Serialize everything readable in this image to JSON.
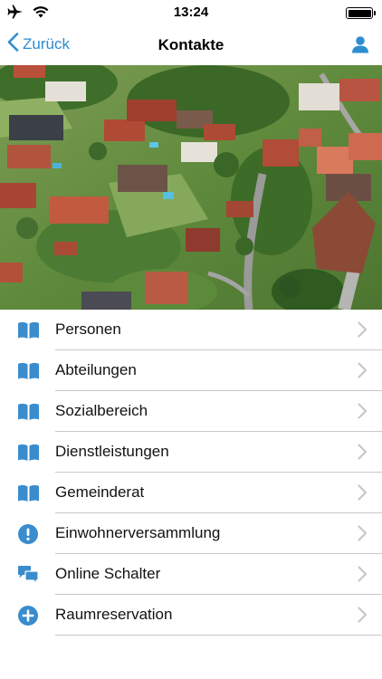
{
  "status_bar": {
    "time": "13:24",
    "icons": [
      "airplane-icon",
      "wifi-icon",
      "battery-icon"
    ]
  },
  "nav": {
    "back_label": "Zurück",
    "title": "Kontakte",
    "right_icon": "profile-icon"
  },
  "hero_image": {
    "description_icon": "village-aerial-photo"
  },
  "menu": [
    {
      "label": "Personen",
      "icon": "book-icon"
    },
    {
      "label": "Abteilungen",
      "icon": "book-icon"
    },
    {
      "label": "Sozialbereich",
      "icon": "book-icon"
    },
    {
      "label": "Dienstleistungen",
      "icon": "book-icon"
    },
    {
      "label": "Gemeinderat",
      "icon": "book-icon"
    },
    {
      "label": "Einwohnerversammlung",
      "icon": "exclamation-circle-icon"
    },
    {
      "label": "Online Schalter",
      "icon": "chat-bubbles-icon"
    },
    {
      "label": "Raumreservation",
      "icon": "plus-circle-icon"
    }
  ],
  "colors": {
    "accent": "#2e8dd0",
    "icon_blue": "#3a8ccd",
    "chevron": "#c7c7cc",
    "separator": "#c8c7cc"
  }
}
